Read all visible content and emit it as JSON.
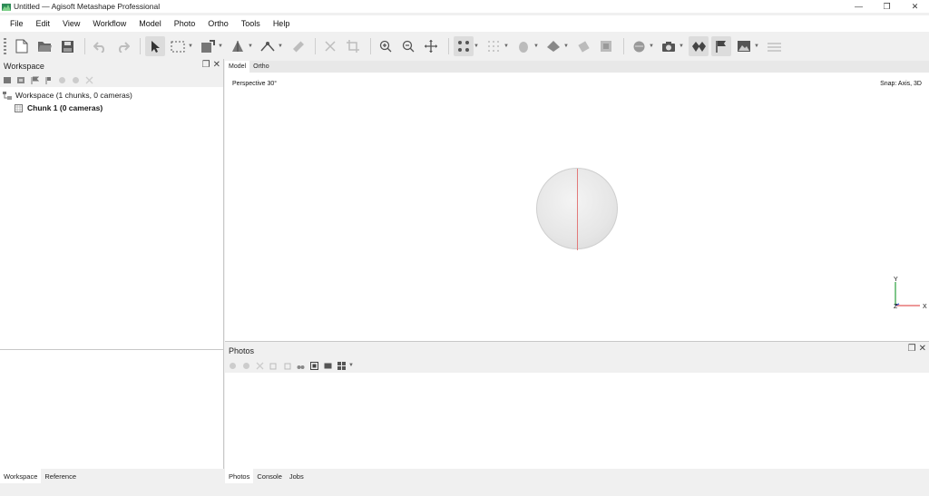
{
  "window": {
    "title": "Untitled — Agisoft Metashape Professional",
    "controls": [
      "—",
      "❐",
      "✕"
    ]
  },
  "menu": [
    "File",
    "Edit",
    "View",
    "Workflow",
    "Model",
    "Photo",
    "Ortho",
    "Tools",
    "Help"
  ],
  "workspace": {
    "title": "Workspace",
    "tree": {
      "root": "Workspace (1 chunks, 0 cameras)",
      "chunk": "Chunk 1 (0 cameras)"
    }
  },
  "view_tabs": [
    "Model",
    "Ortho"
  ],
  "model_view": {
    "projection": "Perspective 30°",
    "snap": "Snap: Axis, 3D",
    "axis_labels": {
      "y": "Y",
      "x": "X",
      "z": "Z"
    }
  },
  "photos": {
    "title": "Photos"
  },
  "bottom_tabs_left": [
    "Workspace",
    "Reference"
  ],
  "bottom_tabs_right": [
    "Photos",
    "Console",
    "Jobs"
  ],
  "colors": {
    "axis_x": "#e25a5a",
    "axis_y": "#3aa84a",
    "axis_z": "#4060d0",
    "sphere_line": "#e27a7a"
  }
}
